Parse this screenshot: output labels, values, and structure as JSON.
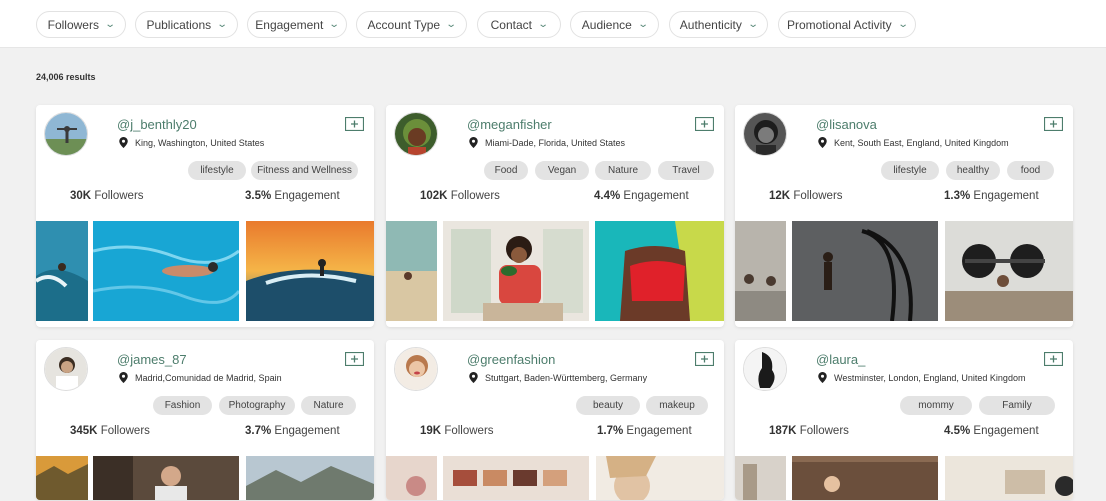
{
  "filters": [
    {
      "label": "Followers"
    },
    {
      "label": "Publications"
    },
    {
      "label": "Engagement"
    },
    {
      "label": "Account Type"
    },
    {
      "label": "Contact"
    },
    {
      "label": "Audience"
    },
    {
      "label": "Authenticity"
    },
    {
      "label": "Promotional Activity"
    }
  ],
  "results_label": "24,006 results",
  "colors": {
    "accent": "#4d7d6c",
    "tag_bg": "#e3e3e3",
    "page_bg": "#f1f1f1"
  },
  "profiles": [
    {
      "handle": "@j_benthly20",
      "location": "King, Washington, United States",
      "tags": [
        "lifestyle",
        "Fitness and Wellness"
      ],
      "followers": "30K",
      "followers_label": "Followers",
      "engagement": "3.5%",
      "engagement_label": "Engagement"
    },
    {
      "handle": "@meganfisher",
      "location": "Miami-Dade, Florida, United States",
      "tags": [
        "Food",
        "Vegan",
        "Nature",
        "Travel"
      ],
      "followers": "102K",
      "followers_label": "Followers",
      "engagement": "4.4%",
      "engagement_label": "Engagement"
    },
    {
      "handle": "@lisanova",
      "location": "Kent, South East, England, United Kingdom",
      "tags": [
        "lifestyle",
        "healthy",
        "food"
      ],
      "followers": "12K",
      "followers_label": "Followers",
      "engagement": "1.3%",
      "engagement_label": "Engagement"
    },
    {
      "handle": "@james_87",
      "location": "Madrid,Comunidad de Madrid, Spain",
      "tags": [
        "Fashion",
        "Photography",
        "Nature"
      ],
      "followers": "345K",
      "followers_label": "Followers",
      "engagement": "3.7%",
      "engagement_label": "Engagement"
    },
    {
      "handle": "@greenfashion",
      "location": "Stuttgart, Baden-Württemberg, Germany",
      "tags": [
        "beauty",
        "makeup"
      ],
      "followers": "19K",
      "followers_label": "Followers",
      "engagement": "1.7%",
      "engagement_label": "Engagement"
    },
    {
      "handle": "@laura_",
      "location": "Westminster, London, England, United Kingdom",
      "tags": [
        "mommy",
        "Family"
      ],
      "followers": "187K",
      "followers_label": "Followers",
      "engagement": "4.5%",
      "engagement_label": "Engagement"
    }
  ]
}
